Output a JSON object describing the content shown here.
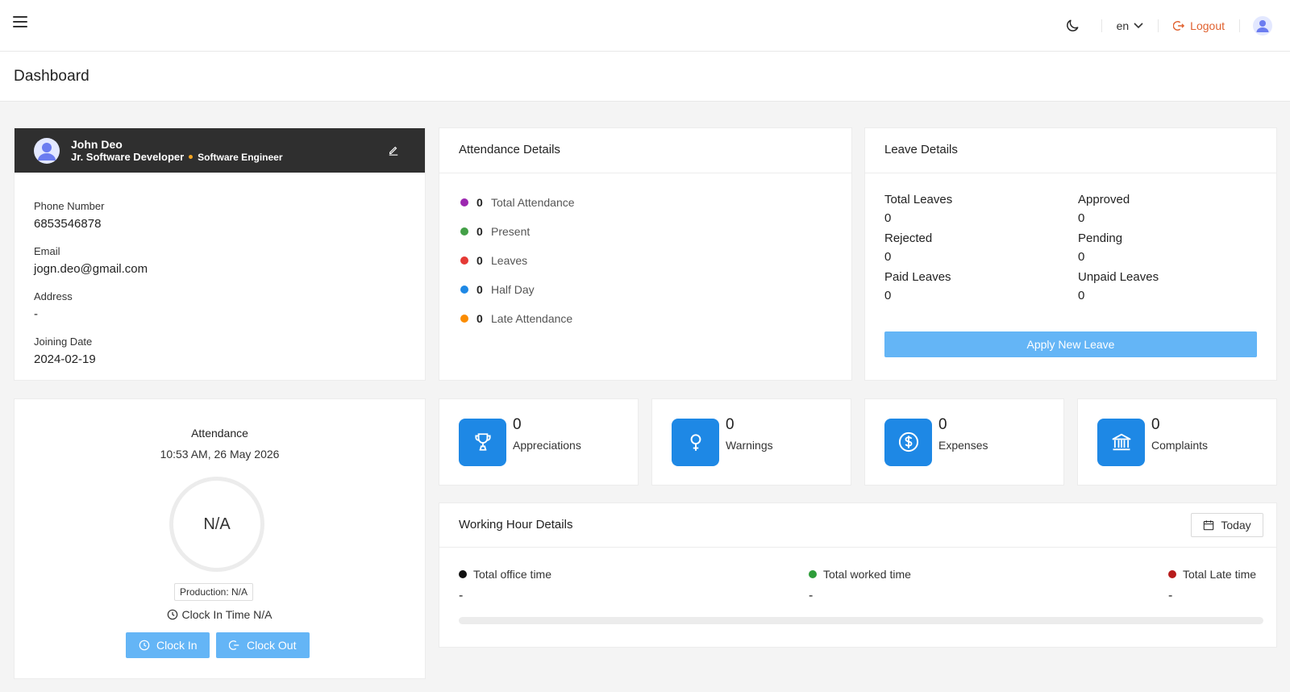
{
  "topbar": {
    "language": "en",
    "logout_label": "Logout"
  },
  "page": {
    "title": "Dashboard"
  },
  "profile": {
    "name": "John Deo",
    "designation": "Jr. Software Developer",
    "department": "Software Engineer",
    "fields": [
      {
        "label": "Phone Number",
        "value": "6853546878"
      },
      {
        "label": "Email",
        "value": "jogn.deo@gmail.com"
      },
      {
        "label": "Address",
        "value": "-"
      },
      {
        "label": "Joining Date",
        "value": "2024-02-19"
      }
    ]
  },
  "attendance_details": {
    "title": "Attendance Details",
    "items": [
      {
        "count": "0",
        "label": "Total Attendance",
        "color": "#9c27b0"
      },
      {
        "count": "0",
        "label": "Present",
        "color": "#43a047"
      },
      {
        "count": "0",
        "label": "Leaves",
        "color": "#e53935"
      },
      {
        "count": "0",
        "label": "Half Day",
        "color": "#1e88e5"
      },
      {
        "count": "0",
        "label": "Late Attendance",
        "color": "#fb8c00"
      }
    ]
  },
  "leave_details": {
    "title": "Leave Details",
    "items": [
      {
        "label": "Total Leaves",
        "value": "0"
      },
      {
        "label": "Approved",
        "value": "0"
      },
      {
        "label": "Rejected",
        "value": "0"
      },
      {
        "label": "Pending",
        "value": "0"
      },
      {
        "label": "Paid Leaves",
        "value": "0"
      },
      {
        "label": "Unpaid Leaves",
        "value": "0"
      }
    ],
    "apply_label": "Apply New Leave"
  },
  "clock": {
    "title": "Attendance",
    "datetime": "10:53 AM, 26 May 2026",
    "ring_value": "N/A",
    "production": "Production: N/A",
    "clock_in_time": "Clock In Time N/A",
    "clock_in_label": "Clock In",
    "clock_out_label": "Clock Out"
  },
  "stats": [
    {
      "value": "0",
      "label": "Appreciations",
      "icon": "trophy-icon"
    },
    {
      "value": "0",
      "label": "Warnings",
      "icon": "female-symbol-icon"
    },
    {
      "value": "0",
      "label": "Expenses",
      "icon": "dollar-circle-icon"
    },
    {
      "value": "0",
      "label": "Complaints",
      "icon": "bank-icon"
    }
  ],
  "working_hours": {
    "title": "Working Hour Details",
    "filter_label": "Today",
    "columns": [
      {
        "label": "Total office time",
        "value": "-",
        "color": "#111111"
      },
      {
        "label": "Total worked time",
        "value": "-",
        "color": "#2e9d3a"
      },
      {
        "label": "Total Late time",
        "value": "-",
        "color": "#b71c1c"
      }
    ],
    "progress": 0
  },
  "colors": {
    "accent": "#1e88e5",
    "button": "#64b5f6",
    "logout": "#e0612f",
    "profile_header": "#2f2f2f"
  }
}
